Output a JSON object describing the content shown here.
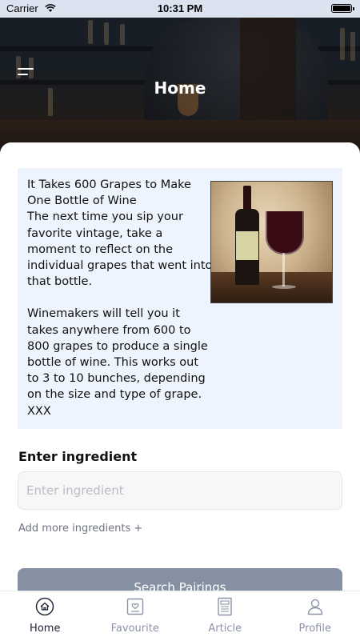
{
  "status_bar": {
    "carrier": "Carrier",
    "time": "10:31 PM"
  },
  "header": {
    "title": "Home",
    "menu_icon": "menu-icon"
  },
  "article": {
    "title": "It Takes 600 Grapes to Make One Bottle of Wine",
    "paragraph1": "The next time you sip your favorite vintage, take a moment to reflect on the individual grapes that went into that bottle.",
    "paragraph2": "Winemakers will tell you it takes anywhere from 600 to 800 grapes to produce a single bottle of wine. This works out to 3 to 10 bunches, depending on the size and type of grape.",
    "signature": "XXX",
    "image": "wine-bottle-and-glass-image"
  },
  "ingredient": {
    "label": "Enter ingredient",
    "placeholder": "Enter ingredient",
    "value": "",
    "add_more": "Add more ingredients +"
  },
  "search": {
    "button_label": "Search Pairings"
  },
  "bottom_nav": {
    "items": [
      {
        "label": "Home",
        "icon": "home-icon",
        "active": true
      },
      {
        "label": "Favourite",
        "icon": "favourite-icon",
        "active": false
      },
      {
        "label": "Article",
        "icon": "article-icon",
        "active": false
      },
      {
        "label": "Profile",
        "icon": "profile-icon",
        "active": false
      }
    ]
  },
  "colors": {
    "accent_dark": "#1c2233",
    "nav_inactive": "#8b93a6",
    "card_bg": "#eef4fd",
    "button_bg": "#8591a3"
  }
}
